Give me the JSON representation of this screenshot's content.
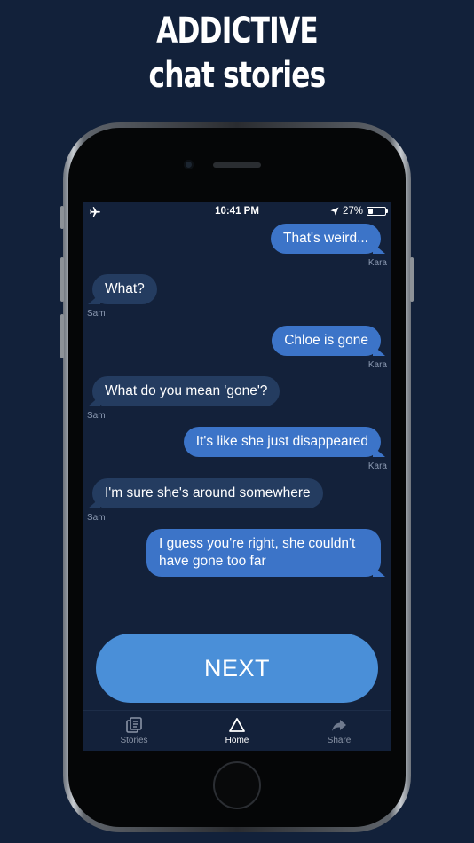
{
  "promo": {
    "line1": "ADDICTIVE",
    "line2": "chat stories"
  },
  "status_bar": {
    "time": "10:41 PM",
    "battery": "27%",
    "battery_level": 0.27,
    "icons": [
      "airplane-icon",
      "location-arrow-icon",
      "battery-icon"
    ]
  },
  "messages": [
    {
      "side": "right",
      "text": "That's weird...",
      "sender": "Kara"
    },
    {
      "side": "left",
      "text": "What?",
      "sender": "Sam"
    },
    {
      "side": "right",
      "text": "Chloe is gone",
      "sender": "Kara"
    },
    {
      "side": "left",
      "text": "What do you mean 'gone'?",
      "sender": "Sam"
    },
    {
      "side": "right",
      "text": "It's like she just disappeared",
      "sender": "Kara"
    },
    {
      "side": "left",
      "text": "I'm sure she's around somewhere",
      "sender": "Sam"
    },
    {
      "side": "right",
      "text": "I guess you're right, she couldn't have gone too far",
      "sender": ""
    }
  ],
  "next_button": {
    "label": "NEXT"
  },
  "tabbar": {
    "tabs": [
      {
        "label": "Stories",
        "icon": "stories-icon",
        "active": false
      },
      {
        "label": "Home",
        "icon": "home-triangle-icon",
        "active": true
      },
      {
        "label": "Share",
        "icon": "share-arrow-icon",
        "active": false
      }
    ]
  },
  "colors": {
    "background": "#12213a",
    "outgoing_bubble": "#3c74c8",
    "incoming_bubble": "#243c60",
    "next_button": "#4a8fd8"
  }
}
